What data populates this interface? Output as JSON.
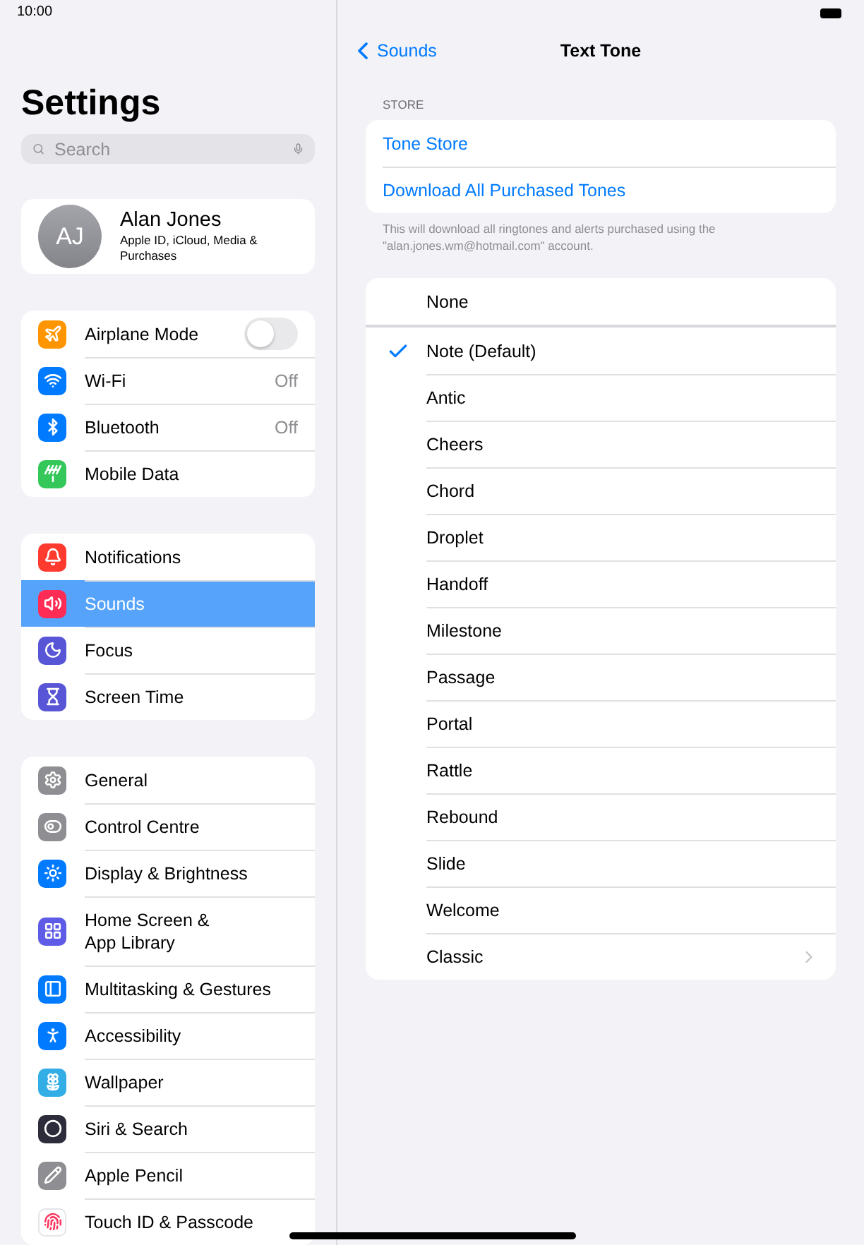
{
  "status_bar": {
    "time": "10:00"
  },
  "sidebar": {
    "title": "Settings",
    "search": {
      "placeholder": "Search"
    },
    "profile": {
      "initials": "AJ",
      "name": "Alan Jones",
      "subtitle": "Apple ID, iCloud, Media & Purchases"
    },
    "groups": [
      {
        "items": [
          {
            "label": "Airplane Mode",
            "kind": "toggle",
            "on": false,
            "selected": false
          },
          {
            "label": "Wi-Fi",
            "kind": "value",
            "value": "Off",
            "selected": false
          },
          {
            "label": "Bluetooth",
            "kind": "value",
            "value": "Off",
            "selected": false
          },
          {
            "label": "Mobile Data",
            "kind": "plain",
            "selected": false
          }
        ]
      },
      {
        "items": [
          {
            "label": "Notifications",
            "kind": "plain",
            "selected": false
          },
          {
            "label": "Sounds",
            "kind": "plain",
            "selected": true
          },
          {
            "label": "Focus",
            "kind": "plain",
            "selected": false
          },
          {
            "label": "Screen Time",
            "kind": "plain",
            "selected": false
          }
        ]
      },
      {
        "items": [
          {
            "label": "General",
            "kind": "plain",
            "selected": false
          },
          {
            "label": "Control Centre",
            "kind": "plain",
            "selected": false
          },
          {
            "label": "Display & Brightness",
            "kind": "plain",
            "selected": false
          },
          {
            "label": "Home Screen & App Library",
            "kind": "plain",
            "selected": false
          },
          {
            "label": "Multitasking & Gestures",
            "kind": "plain",
            "selected": false
          },
          {
            "label": "Accessibility",
            "kind": "plain",
            "selected": false
          },
          {
            "label": "Wallpaper",
            "kind": "plain",
            "selected": false
          },
          {
            "label": "Siri & Search",
            "kind": "plain",
            "selected": false
          },
          {
            "label": "Apple Pencil",
            "kind": "plain",
            "selected": false
          },
          {
            "label": "Touch ID & Passcode",
            "kind": "plain",
            "selected": false
          }
        ]
      }
    ]
  },
  "detail": {
    "back": "Sounds",
    "title": "Text Tone",
    "store": {
      "header": "STORE",
      "links": [
        "Tone Store",
        "Download All Purchased Tones"
      ],
      "footer": "This will download all ringtones and alerts purchased using the \"alan.jones.wm@hotmail.com\" account."
    },
    "tones": [
      {
        "label": "None",
        "kind": "tone",
        "selected": false
      },
      {
        "label": "Note (Default)",
        "kind": "tone",
        "selected": true
      },
      {
        "label": "Antic",
        "kind": "tone",
        "selected": false
      },
      {
        "label": "Cheers",
        "kind": "tone",
        "selected": false
      },
      {
        "label": "Chord",
        "kind": "tone",
        "selected": false
      },
      {
        "label": "Droplet",
        "kind": "tone",
        "selected": false
      },
      {
        "label": "Handoff",
        "kind": "tone",
        "selected": false
      },
      {
        "label": "Milestone",
        "kind": "tone",
        "selected": false
      },
      {
        "label": "Passage",
        "kind": "tone",
        "selected": false
      },
      {
        "label": "Portal",
        "kind": "tone",
        "selected": false
      },
      {
        "label": "Rattle",
        "kind": "tone",
        "selected": false
      },
      {
        "label": "Rebound",
        "kind": "tone",
        "selected": false
      },
      {
        "label": "Slide",
        "kind": "tone",
        "selected": false
      },
      {
        "label": "Welcome",
        "kind": "tone",
        "selected": false
      },
      {
        "label": "Classic",
        "kind": "link",
        "selected": false
      }
    ]
  }
}
